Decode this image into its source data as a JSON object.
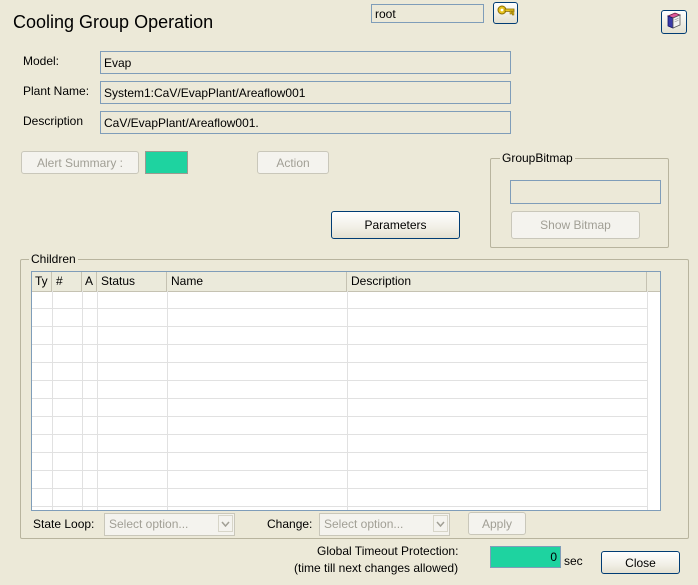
{
  "header": {
    "title": "Cooling Group Operation",
    "user": "root"
  },
  "fields": {
    "model_label": "Model:",
    "model_value": "Evap",
    "plant_label": "Plant Name:",
    "plant_value": "System1:CaV/EvapPlant/Areaflow001",
    "description_label": "Description",
    "description_value": "CaV/EvapPlant/Areaflow001."
  },
  "actions": {
    "alert_summary_label": "Alert Summary :",
    "alert_color": "#1ed3a0",
    "action_label": "Action",
    "parameters_label": "Parameters"
  },
  "group_bitmap": {
    "legend": "GroupBitmap",
    "field_value": "",
    "show_bitmap_label": "Show Bitmap"
  },
  "children": {
    "legend": "Children",
    "columns": [
      "Ty",
      "#",
      "A",
      "Status",
      "Name",
      "Description"
    ],
    "rows": []
  },
  "controls": {
    "state_loop_label": "State Loop:",
    "state_loop_placeholder": "Select option...",
    "change_label": "Change:",
    "change_placeholder": "Select option...",
    "apply_label": "Apply"
  },
  "footer": {
    "timeout_line1": "Global Timeout Protection:",
    "timeout_line2": "(time till next changes allowed)",
    "timeout_value": "0",
    "timeout_unit": "sec",
    "close_label": "Close"
  }
}
